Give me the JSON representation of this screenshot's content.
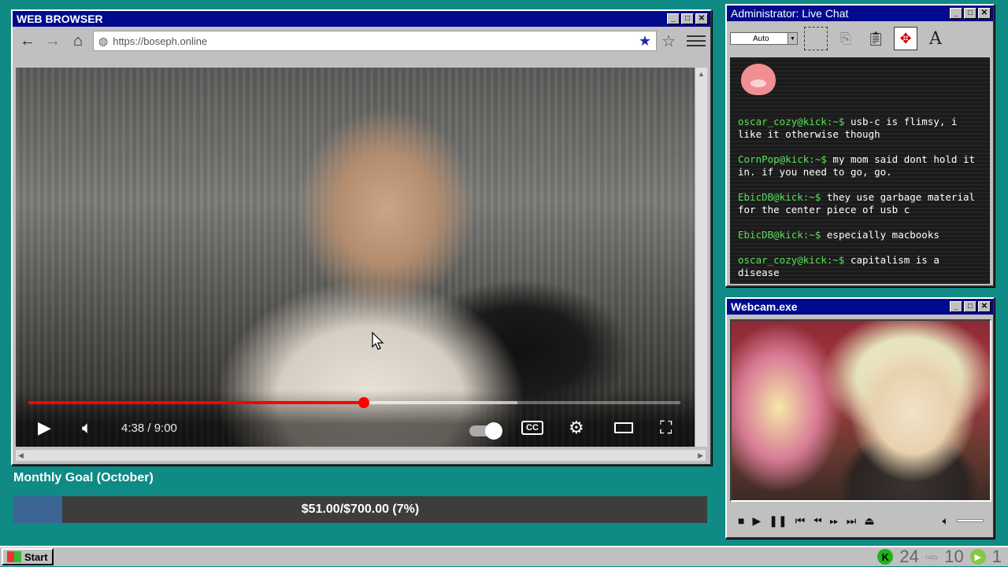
{
  "browser": {
    "title": "WEB BROWSER",
    "url": "https://boseph.online",
    "video": {
      "time": "4:38 / 9:00",
      "progress_fraction": 0.515
    }
  },
  "goal": {
    "title": "Monthly Goal (October)",
    "text": "$51.00/$700.00 (7%)",
    "fraction": 0.07
  },
  "chat": {
    "title": "Administrator: Live Chat",
    "select_value": "Auto",
    "messages": [
      {
        "user": "oscar_cozy@kick:~$",
        "text": "usb-c is flimsy, i like it otherwise though"
      },
      {
        "user": "CornPop@kick:~$",
        "text": "my mom said dont hold it in. if you need to go, go."
      },
      {
        "user": "EbicDB@kick:~$",
        "text": "they use garbage material for the center piece of usb c"
      },
      {
        "user": "EbicDB@kick:~$",
        "text": "especially macbooks"
      },
      {
        "user": "oscar_cozy@kick:~$",
        "text": "capitalism is a disease"
      }
    ]
  },
  "webcam": {
    "title": "Webcam.exe"
  },
  "taskbar": {
    "start_label": "Start",
    "kick_icon": "K",
    "kick_count": "24",
    "cozy_label": "cozy",
    "mid_count": "10",
    "rumble_count": "1"
  }
}
